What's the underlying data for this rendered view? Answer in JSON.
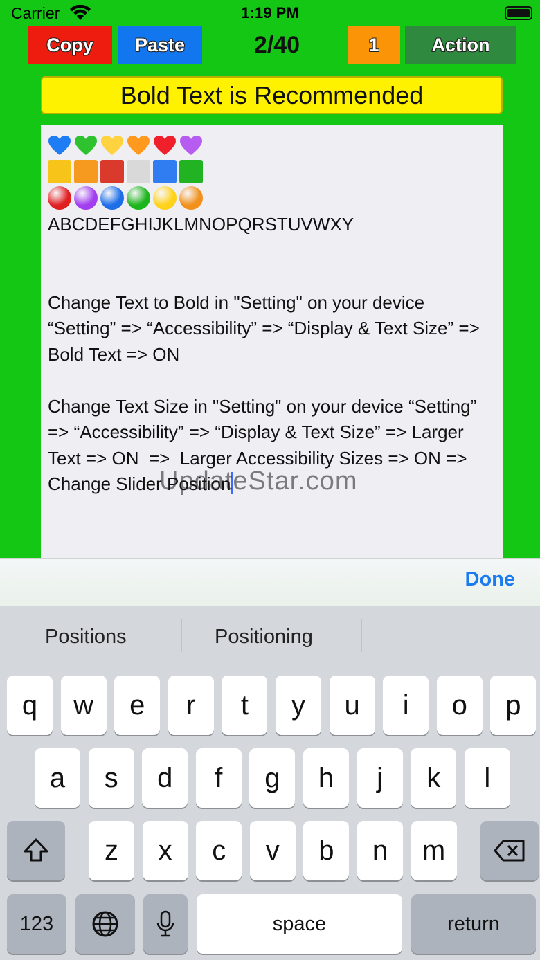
{
  "status_bar": {
    "carrier": "Carrier",
    "time": "1:19 PM"
  },
  "toolbar": {
    "copy_label": "Copy",
    "paste_label": "Paste",
    "page_counter": "2/40",
    "one_label": "1",
    "action_label": "Action"
  },
  "banner": {
    "text": "Bold Text is Recommended"
  },
  "editor": {
    "alphabet": "ABCDEFGHIJKLMNOPQRSTUVWXY",
    "paragraph1": "Change Text to Bold in \"Setting\" on your device “Setting” => “Accessibility” => “Display & Text Size” => Bold Text => ON",
    "paragraph2": "Change Text Size in \"Setting\" on your device “Setting” => “Accessibility” => “Display & Text Size” => Larger Text => ON  =>  Larger Accessibility Sizes => ON => Change Slider Position",
    "heart_colors": [
      "#1e7cf5",
      "#2fc22f",
      "#ffd23f",
      "#ff9a1f",
      "#f0202a",
      "#b65cf0"
    ],
    "square_colors": [
      "#f7c51a",
      "#f59a1e",
      "#d93a2c",
      "#d9d9d9",
      "#2f7df0",
      "#21b321"
    ],
    "circle_colors": [
      "#e01f23",
      "#a23ef0",
      "#1e6ee8",
      "#1cb51c",
      "#ffd21a",
      "#f1901a"
    ]
  },
  "watermark": {
    "text": "UpdateStar.com"
  },
  "accessory": {
    "done_label": "Done"
  },
  "keyboard": {
    "suggestions": [
      "Positions",
      "Positioning"
    ],
    "row1": [
      "q",
      "w",
      "e",
      "r",
      "t",
      "y",
      "u",
      "i",
      "o",
      "p"
    ],
    "row2": [
      "a",
      "s",
      "d",
      "f",
      "g",
      "h",
      "j",
      "k",
      "l"
    ],
    "row3": [
      "z",
      "x",
      "c",
      "v",
      "b",
      "n",
      "m"
    ],
    "numbers_label": "123",
    "space_label": "space",
    "return_label": "return"
  }
}
